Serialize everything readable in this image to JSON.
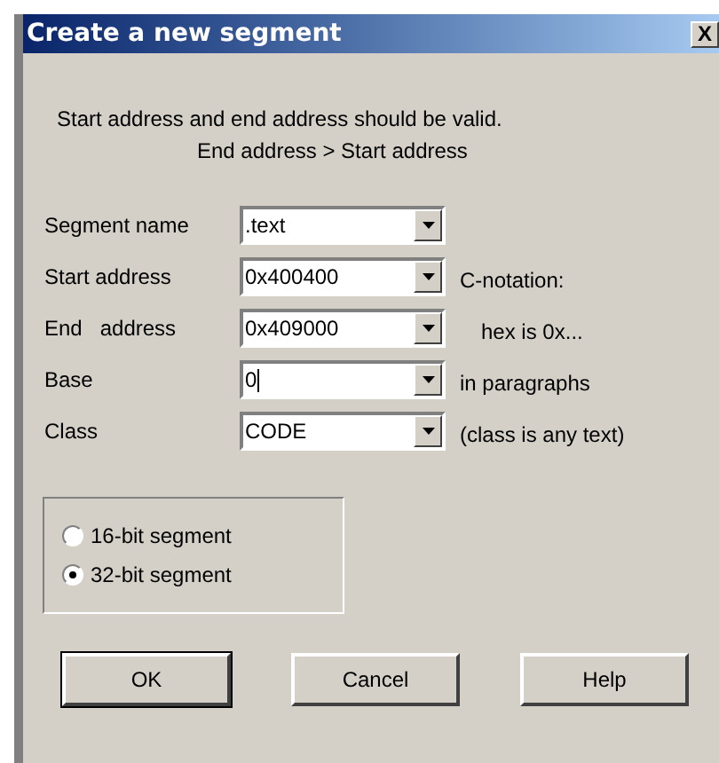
{
  "window": {
    "title": "Create a new segment",
    "close": "X"
  },
  "intro": [
    "Start address and end address should be valid.",
    "End address > Start address"
  ],
  "fields": [
    {
      "label": "Segment name",
      "value": ".text",
      "focused": false
    },
    {
      "label": "Start address",
      "value": "0x400400",
      "note": "C-notation:",
      "focused": false
    },
    {
      "label": "End   address",
      "value": "0x409000",
      "note": "hex is 0x...",
      "focused": false
    },
    {
      "label": "Base",
      "value": "0",
      "note": "in paragraphs",
      "focused": true
    },
    {
      "label": "Class",
      "value": "CODE",
      "note": "(class is any text)",
      "focused": false
    }
  ],
  "bitness": [
    {
      "label": "16-bit segment",
      "selected": false
    },
    {
      "label": "32-bit segment",
      "selected": true
    }
  ],
  "buttons": [
    {
      "label": "OK",
      "default": true
    },
    {
      "label": "Cancel",
      "default": false
    },
    {
      "label": "Help",
      "default": false
    }
  ]
}
